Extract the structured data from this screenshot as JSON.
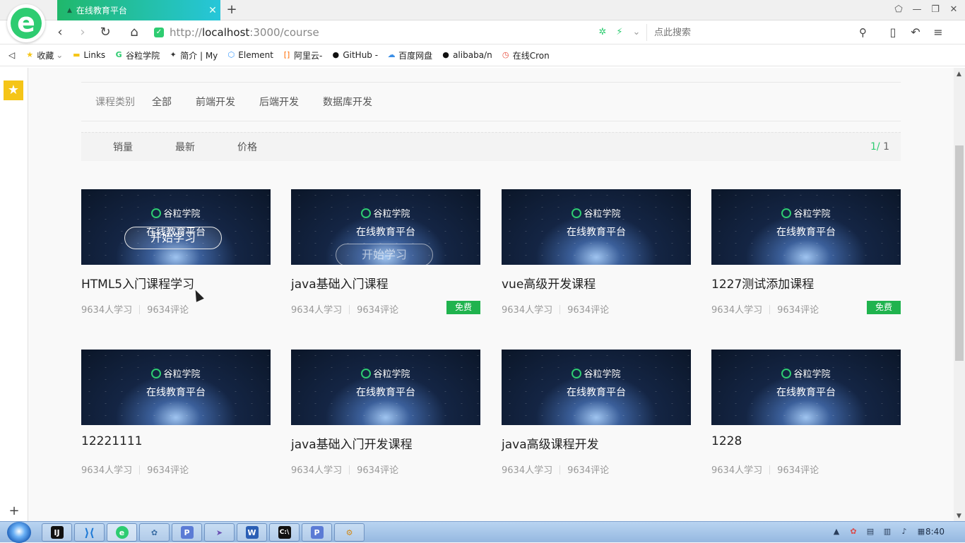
{
  "browser": {
    "tab_title": "在线教育平台",
    "url_prefix": "http://",
    "url_host": "localhost",
    "url_rest": ":3000/course",
    "search_placeholder": "点此搜索"
  },
  "bookmarks": [
    {
      "label": "收藏",
      "icon": "star-icon"
    },
    {
      "label": "Links",
      "icon": "folder-icon"
    },
    {
      "label": "谷粒学院",
      "icon": "guli-icon"
    },
    {
      "label": "简介 | My",
      "icon": "bird-icon"
    },
    {
      "label": "Element",
      "icon": "element-icon"
    },
    {
      "label": "阿里云-",
      "icon": "aliyun-icon"
    },
    {
      "label": "GitHub -",
      "icon": "github-icon"
    },
    {
      "label": "百度网盘",
      "icon": "baidu-icon"
    },
    {
      "label": "alibaba/n",
      "icon": "github-icon"
    },
    {
      "label": "在线Cron",
      "icon": "cron-icon"
    }
  ],
  "filters": {
    "category_label": "课程类别",
    "categories": [
      "全部",
      "前端开发",
      "后端开发",
      "数据库开发"
    ],
    "sorts": [
      "销量",
      "最新",
      "价格"
    ],
    "page_current": "1/",
    "page_total": " 1"
  },
  "thumbnail": {
    "brand": "谷粒学院",
    "subtitle": "在线教育平台",
    "start_label": "开始学习"
  },
  "courses": [
    {
      "title": "HTML5入门课程学习",
      "students": "9634人学习",
      "comments": "9634评论",
      "badge": ""
    },
    {
      "title": "java基础入门课程",
      "students": "9634人学习",
      "comments": "9634评论",
      "badge": "免费"
    },
    {
      "title": "vue高级开发课程",
      "students": "9634人学习",
      "comments": "9634评论",
      "badge": ""
    },
    {
      "title": "1227测试添加课程",
      "students": "9634人学习",
      "comments": "9634评论",
      "badge": "免费"
    },
    {
      "title": "12221111",
      "students": "9634人学习",
      "comments": "9634评论",
      "badge": ""
    },
    {
      "title": "java基础入门开发课程",
      "students": "9634人学习",
      "comments": "9634评论",
      "badge": ""
    },
    {
      "title": "java高级课程开发",
      "students": "9634人学习",
      "comments": "9634评论",
      "badge": ""
    },
    {
      "title": "1228",
      "students": "9634人学习",
      "comments": "9634评论",
      "badge": ""
    }
  ],
  "taskbar": {
    "clock": "8:40"
  },
  "colors": {
    "accent": "#2ecc71",
    "free_badge": "#20b34e"
  }
}
